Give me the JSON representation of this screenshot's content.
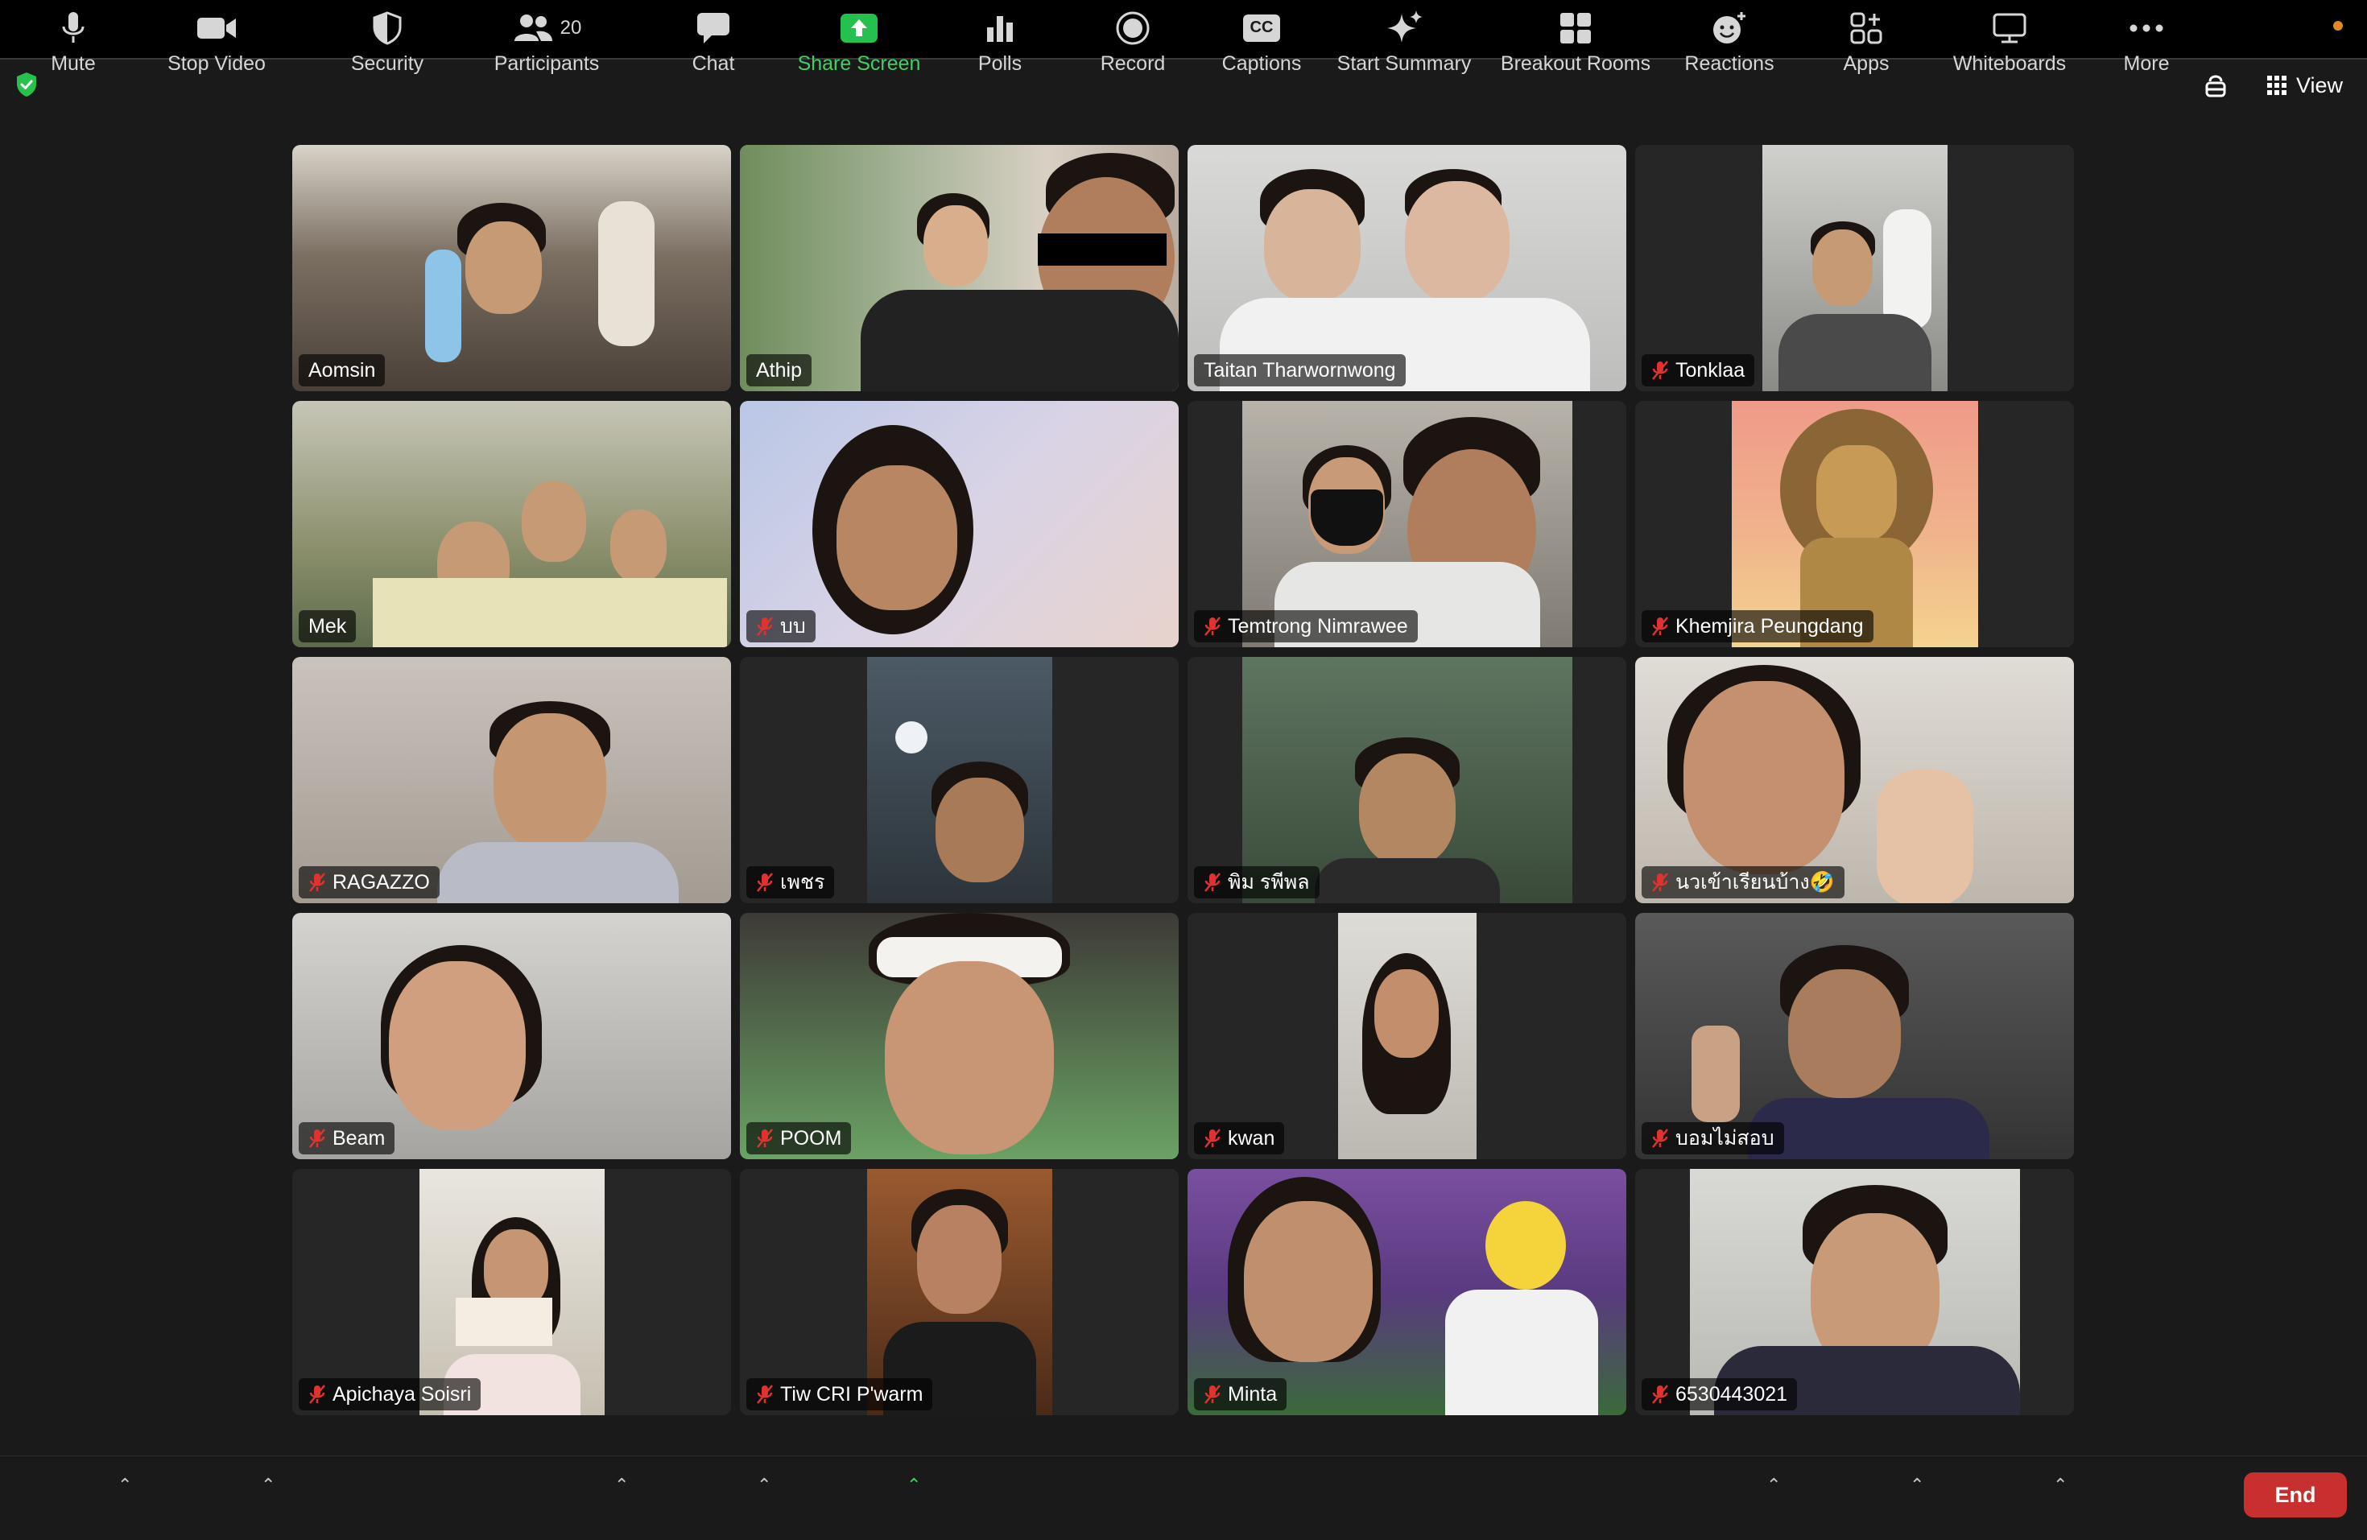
{
  "top": {
    "view_label": "View"
  },
  "participants": [
    {
      "name": "Aomsin",
      "muted": false,
      "bg": "#6f6a62",
      "active": false
    },
    {
      "name": "Athip",
      "muted": false,
      "bg": "#7c8c6a",
      "active": true
    },
    {
      "name": "Taitan Tharwornwong",
      "muted": false,
      "bg": "#b8b8b6",
      "active": false
    },
    {
      "name": "Tonklaa",
      "muted": true,
      "bg": "#9a9a96",
      "active": false
    },
    {
      "name": "Mek",
      "muted": false,
      "bg": "#8e9270",
      "active": false
    },
    {
      "name": "บบ",
      "muted": true,
      "bg": "#c9c7dc",
      "active": false
    },
    {
      "name": "Temtrong Nimrawee",
      "muted": true,
      "bg": "#9c978e",
      "active": false
    },
    {
      "name": "Khemjira Peungdang",
      "muted": true,
      "bg": "#e7a58b",
      "active": false
    },
    {
      "name": "RAGAZZO",
      "muted": true,
      "bg": "#a09992",
      "active": false
    },
    {
      "name": "เพชร",
      "muted": true,
      "bg": "#3f4a55",
      "active": false
    },
    {
      "name": "พิม รพีพล",
      "muted": true,
      "bg": "#4b5e48",
      "active": false
    },
    {
      "name": "นวเข้าเรียนบ้าง🤣",
      "muted": true,
      "bg": "#cfc8bf",
      "active": false
    },
    {
      "name": "Beam",
      "muted": true,
      "bg": "#a7a6a4",
      "active": false
    },
    {
      "name": "POOM",
      "muted": true,
      "bg": "#5d9a5a",
      "active": false
    },
    {
      "name": "kwan",
      "muted": true,
      "bg": "#d0cfca",
      "active": false
    },
    {
      "name": "บอมไม่สอบ",
      "muted": true,
      "bg": "#4a4a4a",
      "active": false
    },
    {
      "name": "Apichaya Soisri",
      "muted": true,
      "bg": "#bdb8ad",
      "active": false
    },
    {
      "name": "Tiw CRI P'warm",
      "muted": true,
      "bg": "#8a4a28",
      "active": false
    },
    {
      "name": "Minta",
      "muted": true,
      "bg": "#6b4a8a",
      "active": false
    },
    {
      "name": "6530443021",
      "muted": true,
      "bg": "#cfcfcc",
      "active": false
    }
  ],
  "toolbar": {
    "mute": "Mute",
    "stop_video": "Stop Video",
    "security": "Security",
    "participants": "Participants",
    "participant_count": "20",
    "chat": "Chat",
    "share_screen": "Share Screen",
    "polls": "Polls",
    "record": "Record",
    "captions": "Captions",
    "captions_icon_text": "CC",
    "start_summary": "Start Summary",
    "breakout_rooms": "Breakout Rooms",
    "reactions": "Reactions",
    "apps": "Apps",
    "whiteboards": "Whiteboards",
    "more": "More",
    "end": "End"
  }
}
